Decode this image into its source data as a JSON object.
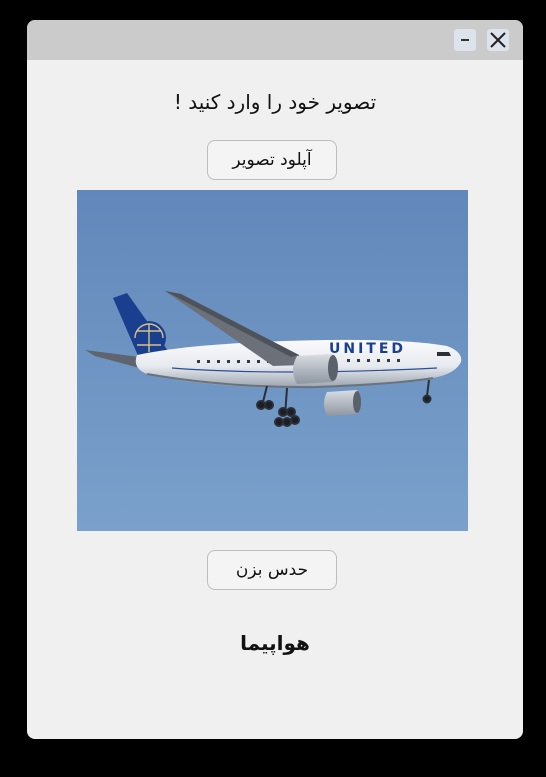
{
  "window": {
    "minimize_glyph": "−",
    "close_glyph": "✕"
  },
  "main": {
    "heading": "تصویر خود را وارد کنید !",
    "upload_button": "آپلود تصویر",
    "detect_button": "حدس بزن",
    "result": "هواپیما"
  },
  "image": {
    "subject": "passenger airplane in flight",
    "livery_text": "UNITED",
    "sky_color": "#6a91bf"
  }
}
